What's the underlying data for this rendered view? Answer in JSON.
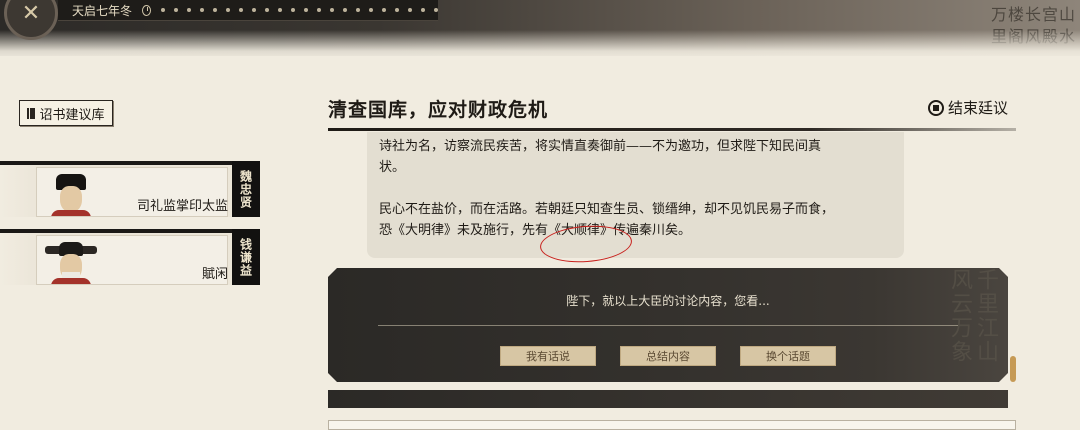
{
  "header": {
    "date": "天启七年冬",
    "emblem_icon": "crest-icon",
    "timeline_dots": 22,
    "banner_calligraphy": "山水宫殿长风楼阁万里"
  },
  "sidebar": {
    "edict_button": "诏书建议库",
    "ministers": [
      {
        "name": "魏忠贤",
        "title": "司礼监掌印太监"
      },
      {
        "name": "钱谦益",
        "title": "賦闲"
      }
    ]
  },
  "main": {
    "title": "清查国库，应对财政危机",
    "end_button": "结束廷议",
    "paragraphs": [
      "诗社为名，访察流民疾苦，将实情直奏御前——不为邀功，但求陛下知民间真",
      "状。",
      "民心不在盐价，而在活路。若朝廷只知查生员、锁缙绅，却不见饥民易子而食，",
      "恐《大明律》未及施行，先有《大顺律》传遍秦川矣。"
    ],
    "annotation": "red-circle"
  },
  "prompt": {
    "text": "陛下，就以上大臣的讨论内容，您看...",
    "choices": [
      "我有话说",
      "总结内容",
      "换个话题"
    ],
    "background_calligraphy": "千里江山风云万象"
  },
  "colors": {
    "paper": "#f1ece0",
    "ink": "#1f1b16",
    "panel": "#2b2926",
    "choice": "#d7c6a4",
    "annotation": "#c8201c"
  }
}
